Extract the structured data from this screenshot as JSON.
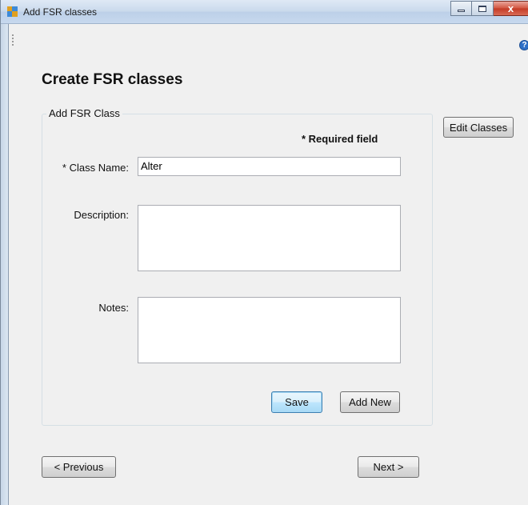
{
  "window": {
    "title": "Add FSR classes",
    "controls": {
      "minimize": "",
      "maximize": "",
      "close": "x"
    }
  },
  "toolbar": {
    "help_icon": "?"
  },
  "page": {
    "title": "Create FSR classes"
  },
  "group": {
    "label": "Add FSR Class",
    "required_note": "* Required field"
  },
  "form": {
    "class_name_label": "* Class Name:",
    "class_name_value": "Alter",
    "description_label": "Description:",
    "description_value": "",
    "notes_label": "Notes:",
    "notes_value": ""
  },
  "buttons": {
    "save": "Save",
    "add_new": "Add New",
    "edit_classes": "Edit Classes",
    "previous": "< Previous",
    "next": "Next >"
  }
}
